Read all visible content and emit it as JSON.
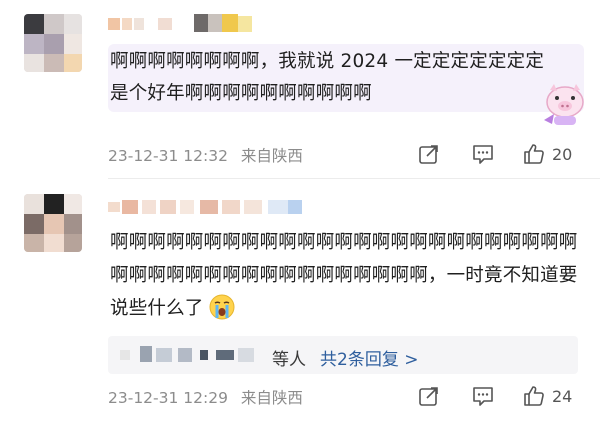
{
  "comments": [
    {
      "text": "啊啊啊啊啊啊啊啊，我就说 2024 一定定定定定定定是个好年啊啊啊啊啊啊啊啊啊啊",
      "date": "23-12-31 12:32",
      "location": "来自陕西",
      "likes": "20",
      "icons": {
        "share": "share-icon",
        "comment": "comment-icon",
        "like": "thumbs-up-icon"
      }
    },
    {
      "text_main": "啊啊啊啊啊啊啊啊啊啊啊啊啊啊啊啊啊啊啊啊啊啊啊啊啊啊啊啊啊啊啊啊啊啊啊啊啊啊啊啊啊啊，一时竟不知道要说些什么了",
      "emoji": "crying-face-emoji",
      "replies_who": "等人",
      "replies_total": "共2条回复 >",
      "date": "23-12-31 12:29",
      "location": "来自陕西",
      "likes": "24",
      "icons": {
        "share": "share-icon",
        "comment": "comment-icon",
        "like": "thumbs-up-icon"
      }
    }
  ],
  "colors": {
    "highlight": "#f5f1fb",
    "reply_link": "#2f5f9e",
    "meta": "#8c8c8c"
  }
}
